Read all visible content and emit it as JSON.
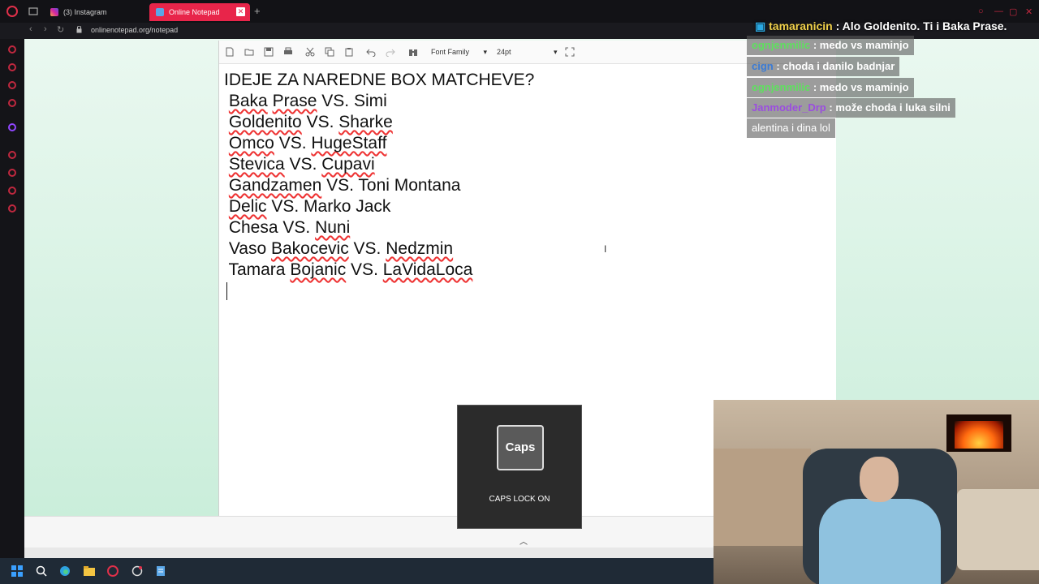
{
  "browser": {
    "tabs": [
      {
        "label": "(3) Instagram",
        "active": false
      },
      {
        "label": "Online Notepad",
        "active": true
      }
    ],
    "url": "onlinenotepad.org/notepad",
    "accent_color": "#e8254a"
  },
  "notepad": {
    "toolbar": {
      "font_family_label": "Font Family",
      "font_size_label": "24pt"
    },
    "lines": [
      "IDEJE ZA NAREDNE BOX MATCHEVE?",
      " Baka Prase VS. Simi",
      " Goldenito VS. Sharke",
      " Omco VS. HugeStaff",
      " Stevica VS. Cupavi",
      " Gandzamen VS. Toni Montana",
      " Delic VS. Marko Jack",
      " Chesa VS. Nuni",
      " Vaso Bakocevic VS. Nedzmin",
      " Tamara Bojanic VS. LaVidaLoca"
    ]
  },
  "chat": {
    "messages": [
      {
        "user": "tamaranicin",
        "text": "Alo Goldenito. Ti i Baka Prase.",
        "user_color": "#f0d04a"
      },
      {
        "user": "ognjenmilic",
        "text": "medo vs maminjo",
        "user_color": "#5ee05e"
      },
      {
        "user": "cign",
        "text": "choda i danilo badnjar",
        "user_color": "#3a7bd5"
      },
      {
        "user": "ognjenmilic",
        "text": "medo vs maminjo",
        "user_color": "#5ee05e"
      },
      {
        "user": "Janmoder_Drp",
        "text": "može choda i luka silni",
        "user_color": "#9b4de0"
      },
      {
        "user": "",
        "text": "alentina i dina lol",
        "user_color": "#ffffff"
      }
    ]
  },
  "caps_overlay": {
    "key_label": "Caps",
    "status": "CAPS LOCK ON"
  }
}
